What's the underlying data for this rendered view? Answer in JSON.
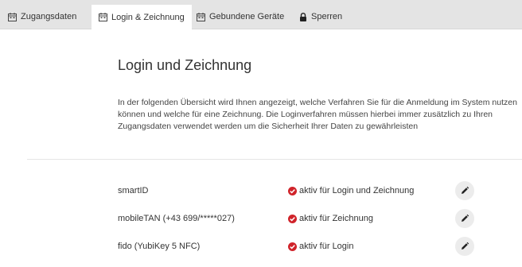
{
  "tabs": [
    {
      "label": "Zugangsdaten",
      "icon": "calendar-icon"
    },
    {
      "label": "Login & Zeichnung",
      "icon": "calendar-icon",
      "active": true
    },
    {
      "label": "Gebundene Geräte",
      "icon": "calendar-icon"
    },
    {
      "label": "Sperren",
      "icon": "lock-icon"
    }
  ],
  "page": {
    "title": "Login und Zeichnung",
    "description": "In der folgenden Übersicht wird Ihnen angezeigt, welche Verfahren Sie für die Anmeldung im System nutzen können und welche für eine Zeichnung. Die Loginverfahren müssen hierbei immer zusätzlich zu Ihren Zugangsdaten verwendet werden um die Sicherheit Ihrer Daten zu gewährleisten"
  },
  "methods": [
    {
      "name": "smartID",
      "status": "aktiv für Login und Zeichnung"
    },
    {
      "name": "mobileTAN (+43 699/*****027)",
      "status": "aktiv für Zeichnung"
    },
    {
      "name": "fido (YubiKey 5 NFC)",
      "status": "aktiv für Login"
    }
  ],
  "colors": {
    "status_check": "#d0232a",
    "tabbar": "#e4e4e4"
  }
}
